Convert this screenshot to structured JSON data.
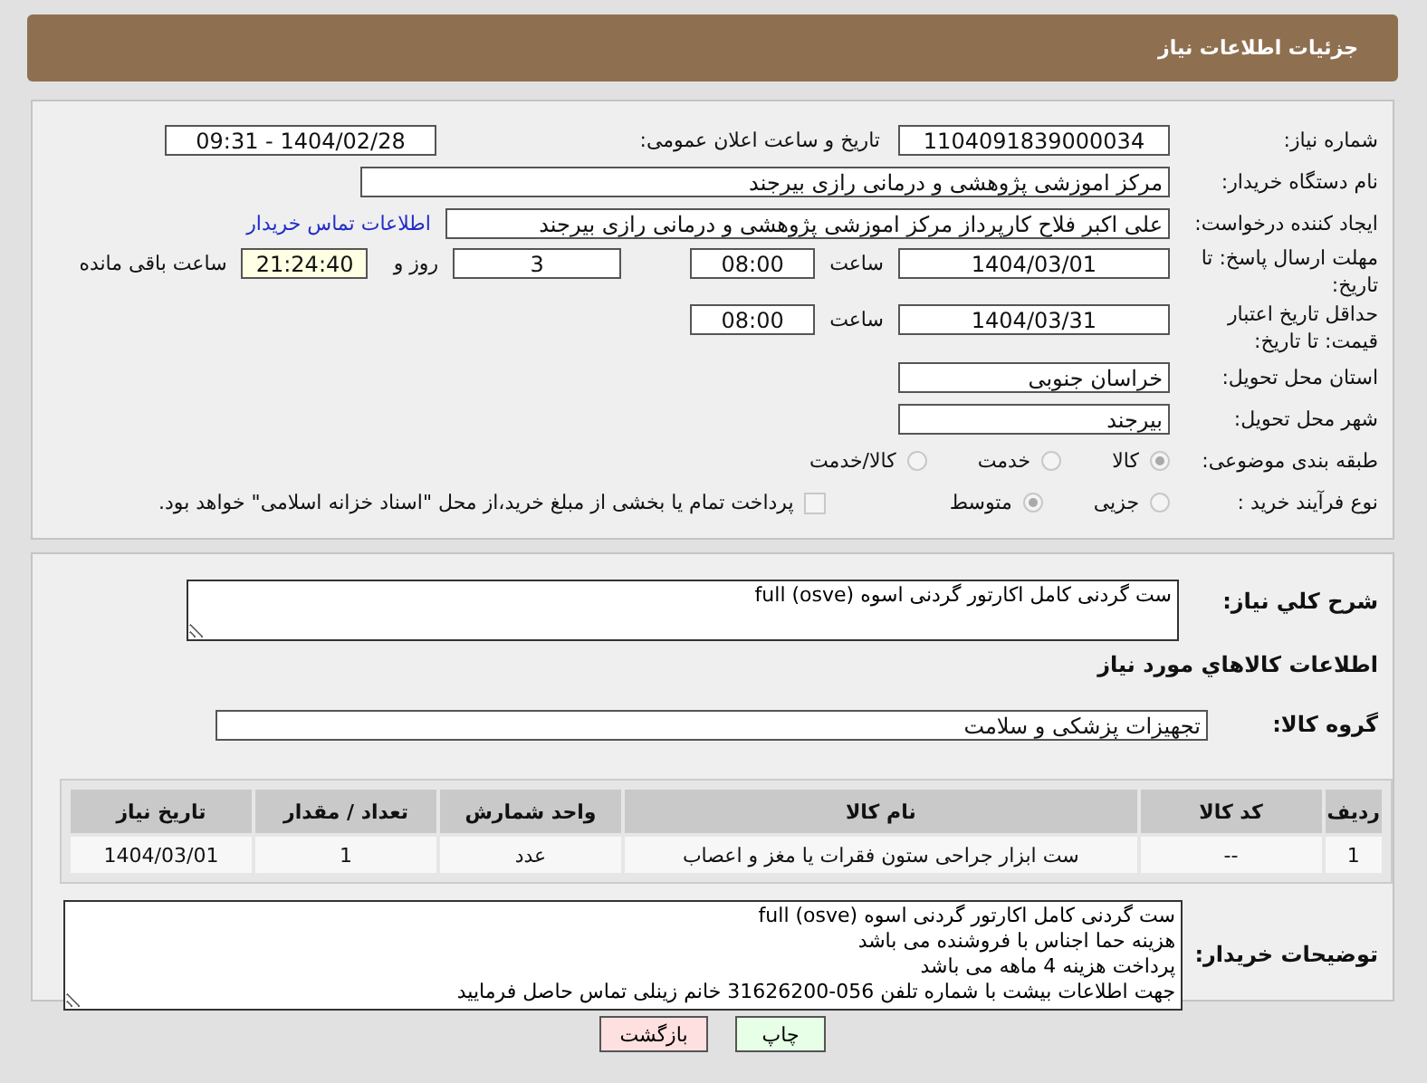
{
  "page_title": "جزئیات اطلاعات نیاز",
  "need_number": {
    "label": "شماره نیاز:",
    "value": "1104091839000034"
  },
  "announce": {
    "label": "تاریخ و ساعت اعلان عمومی:",
    "value": "1404/02/28 - 09:31"
  },
  "buyer": {
    "label": "نام دستگاه خریدار:",
    "value": "مرکز اموزشی پژوهشی و درمانی رازی بیرجند"
  },
  "requester": {
    "label": "ایجاد کننده درخواست:",
    "value": "علی اکبر فلاح کارپرداز مرکز اموزشی پژوهشی و درمانی رازی بیرجند",
    "link": "اطلاعات تماس خریدار"
  },
  "deadline": {
    "label": "مهلت ارسال پاسخ: تا تاریخ:",
    "date": "1404/03/01",
    "time_label": "ساعت",
    "time": "08:00",
    "days": "3",
    "days_label": "روز و",
    "remaining": "21:24:40",
    "remaining_label": "ساعت باقی مانده"
  },
  "validity": {
    "label": "حداقل تاریخ اعتبار قیمت: تا تاریخ:",
    "date": "1404/03/31",
    "time_label": "ساعت",
    "time": "08:00"
  },
  "province": {
    "label": "استان محل تحویل:",
    "value": "خراسان جنوبی"
  },
  "city": {
    "label": "شهر محل تحویل:",
    "value": "بیرجند"
  },
  "category": {
    "label": "طبقه بندی موضوعی:",
    "options": [
      {
        "label": "کالا",
        "selected": true
      },
      {
        "label": "خدمت",
        "selected": false
      },
      {
        "label": "کالا/خدمت",
        "selected": false
      }
    ]
  },
  "process": {
    "label": "نوع فرآیند خرید :",
    "options": [
      {
        "label": "جزیی",
        "selected": false
      },
      {
        "label": "متوسط",
        "selected": true
      }
    ],
    "payment": {
      "checked": false,
      "text": "پرداخت تمام یا بخشی از مبلغ خرید،از محل \"اسناد خزانه اسلامی\" خواهد بود."
    }
  },
  "description": {
    "label": "شرح کلي نياز:",
    "value": "ست گردنی کامل اکارتور گردنی اسوه full (osve)"
  },
  "goods_title": "اطلاعات کالاهاي مورد نياز",
  "goods_group": {
    "label": "گروه کالا:",
    "value": "تجهیزات پزشکی و سلامت"
  },
  "table": {
    "columns": [
      "ردیف",
      "کد کالا",
      "نام کالا",
      "واحد شمارش",
      "تعداد / مقدار",
      "تاریخ نیاز"
    ],
    "rows": [
      [
        "1",
        "--",
        "ست ابزار جراحی ستون فقرات یا مغز و اعصاب",
        "عدد",
        "1",
        "1404/03/01"
      ]
    ]
  },
  "buyer_notes": {
    "label": "توضیحات خریدار:",
    "lines": [
      "ست گردنی کامل اکارتور گردنی اسوه full (osve)",
      "هزینه حما اجناس با فروشنده می باشد",
      "پرداخت هزینه 4 ماهه می باشد",
      "جهت اطلاعات بیشت با شماره تلفن 056-31626200 خانم زینلی تماس حاصل فرمایید"
    ]
  },
  "buttons": [
    {
      "label": "چاپ",
      "kind": "print"
    },
    {
      "label": "بازگشت",
      "kind": "back"
    }
  ]
}
